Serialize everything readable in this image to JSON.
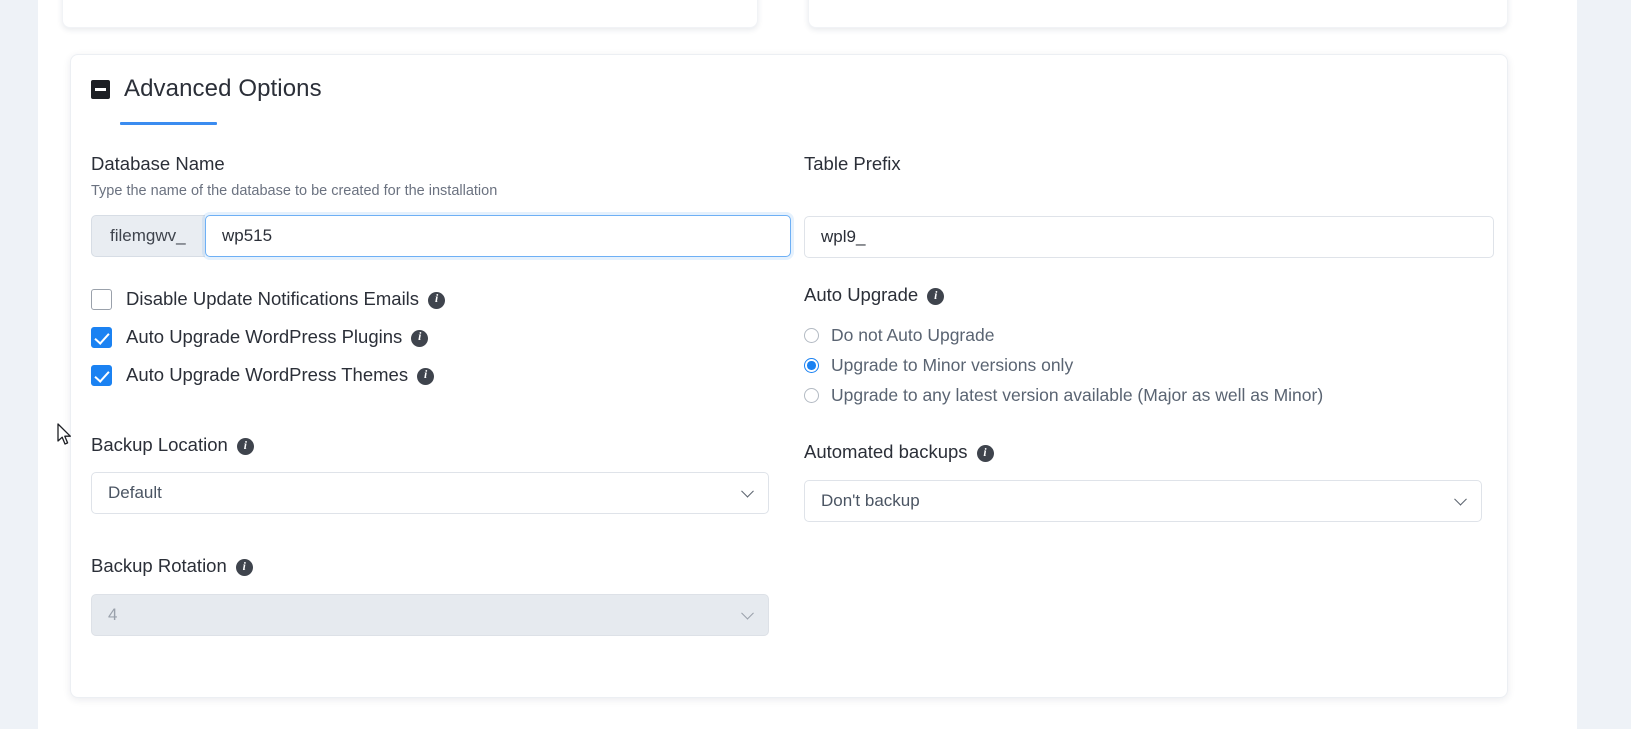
{
  "page": {
    "background_color": "#eef2f7",
    "card_background": "#ffffff",
    "accent_color": "#3b8cf0"
  },
  "card": {
    "title": "Advanced Options",
    "collapse_icon": "minus-square-icon",
    "collapsed": false
  },
  "left_column": {
    "database_name": {
      "label": "Database Name",
      "hint": "Type the name of the database to be created for the installation",
      "prefix": "filemgwv_",
      "value": "wp515",
      "focused": true
    },
    "checkboxes": [
      {
        "label": "Disable Update Notifications Emails",
        "checked": false,
        "info_icon": "info-icon"
      },
      {
        "label": "Auto Upgrade WordPress Plugins",
        "checked": true,
        "info_icon": "info-icon"
      },
      {
        "label": "Auto Upgrade WordPress Themes",
        "checked": true,
        "info_icon": "info-icon"
      }
    ],
    "backup_location": {
      "label": "Backup Location",
      "info_icon": "info-icon",
      "value": "Default",
      "disabled": false
    },
    "backup_rotation": {
      "label": "Backup Rotation",
      "info_icon": "info-icon",
      "value": "4",
      "disabled": true
    }
  },
  "right_column": {
    "table_prefix": {
      "label": "Table Prefix",
      "value": "wpl9_"
    },
    "auto_upgrade": {
      "label": "Auto Upgrade",
      "info_icon": "info-icon",
      "options": [
        {
          "label": "Do not Auto Upgrade",
          "selected": false
        },
        {
          "label": "Upgrade to Minor versions only",
          "selected": true
        },
        {
          "label": "Upgrade to any latest version available (Major as well as Minor)",
          "selected": false
        }
      ]
    },
    "automated_backups": {
      "label": "Automated backups",
      "info_icon": "info-icon",
      "value": "Don't backup",
      "disabled": false
    }
  },
  "icons": {
    "info": "i",
    "chevron_down": "chevron-down-icon",
    "cursor": "mouse-pointer-icon"
  }
}
